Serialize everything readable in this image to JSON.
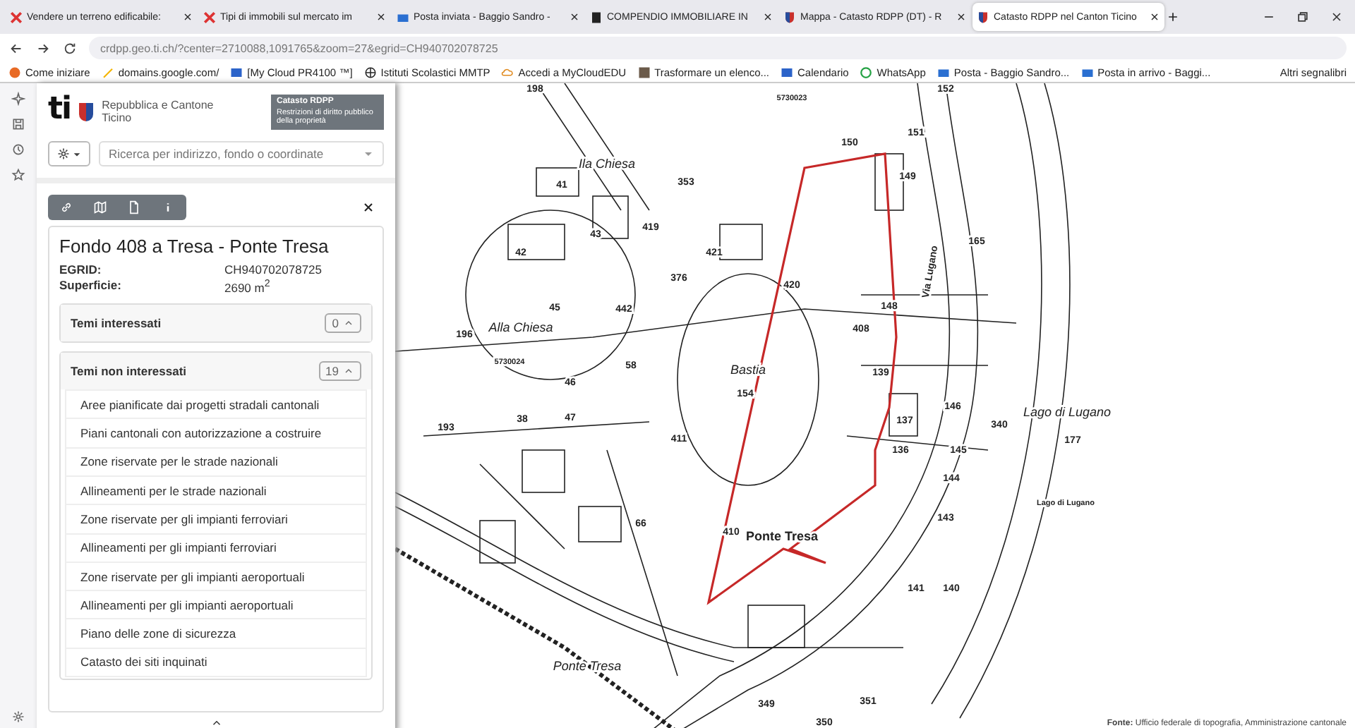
{
  "browser": {
    "tabs": [
      {
        "title": "Vendere un terreno edificabile:",
        "selected": false,
        "kind": "tool"
      },
      {
        "title": "Tipi di immobili sul mercato im",
        "selected": false,
        "kind": "tool"
      },
      {
        "title": "Posta inviata - Baggio Sandro -",
        "selected": false,
        "kind": "mail"
      },
      {
        "title": "COMPENDIO IMMOBILIARE IN",
        "selected": false,
        "kind": "doc"
      },
      {
        "title": "Mappa - Catasto RDPP (DT) - R",
        "selected": false,
        "kind": "shield"
      },
      {
        "title": "Catasto RDPP nel Canton Ticino",
        "selected": true,
        "kind": "shield"
      }
    ],
    "url": "crdpp.geo.ti.ch/?center=2710088,1091765&zoom=27&egrid=CH940702078725",
    "bookmarks": [
      {
        "label": "Come iniziare",
        "kind": "fox"
      },
      {
        "label": "domains.google.com/",
        "kind": "pen"
      },
      {
        "label": "[My Cloud PR4100 ™]",
        "kind": "card"
      },
      {
        "label": "Istituti Scolastici MMTP",
        "kind": "globe"
      },
      {
        "label": "Accedi a MyCloudEDU",
        "kind": "cloud"
      },
      {
        "label": "Trasformare un elenco...",
        "kind": "img"
      },
      {
        "label": "Calendario",
        "kind": "card"
      },
      {
        "label": "WhatsApp",
        "kind": "whats"
      },
      {
        "label": "Posta - Baggio Sandro...",
        "kind": "mail"
      },
      {
        "label": "Posta in arrivo - Baggi...",
        "kind": "mail"
      }
    ],
    "other_bookmarks": "Altri segnalibri"
  },
  "app": {
    "logo": "ti",
    "org": "Repubblica e Cantone\nTicino",
    "badge_title": "Catasto RDPP",
    "badge_text": "Restrizioni di diritto pubblico della proprietà",
    "search": {
      "placeholder": "Ricerca per indirizzo, fondo o coordinate"
    },
    "parcel": {
      "title": "Fondo 408 a Tresa - Ponte Tresa",
      "fields": [
        {
          "label": "EGRID:",
          "value": "CH940702078725"
        },
        {
          "label": "Superficie:",
          "value": "2690 m$^{2}$"
        }
      ]
    },
    "sections": [
      {
        "title": "Temi interessati",
        "count": "0"
      },
      {
        "title": "Temi non interessati",
        "count": "19",
        "items": [
          "Aree pianificate dai progetti stradali cantonali",
          "Piani cantonali con autorizzazione a costruire",
          "Zone riservate per le strade nazionali",
          "Allineamenti per le strade nazionali",
          "Zone riservate per gli impianti ferroviari",
          "Allineamenti per gli impianti ferroviari",
          "Zone riservate per gli impianti aeroportuali",
          "Allineamenti per gli impianti aeroportuali",
          "Piano delle zone di sicurezza",
          "Catasto dei siti inquinati"
        ]
      }
    ]
  },
  "map": {
    "labels": [
      "198",
      "152",
      "5730023",
      "151",
      "150",
      "149",
      "Ila Chiesa",
      "41",
      "353",
      "419",
      "43",
      "421",
      "42",
      "165",
      "Via Lugano",
      "376",
      "420",
      "45",
      "442",
      "408",
      "Alla Chiesa",
      "196",
      "148",
      "58",
      "Bastia",
      "5730024",
      "46",
      "154",
      "139",
      "146",
      "47",
      "340",
      "Lago di Lugano",
      "38",
      "193",
      "137",
      "145",
      "177",
      "411",
      "136",
      "144",
      "Lago di Lugano",
      "143",
      "66",
      "410",
      "Ponte Tresa",
      "141",
      "140",
      "Ponte Tresa",
      "351",
      "349",
      "350"
    ],
    "source_label": "Fonte:",
    "source": "Ufficio federale di topografia, Amministrazione cantonale"
  }
}
